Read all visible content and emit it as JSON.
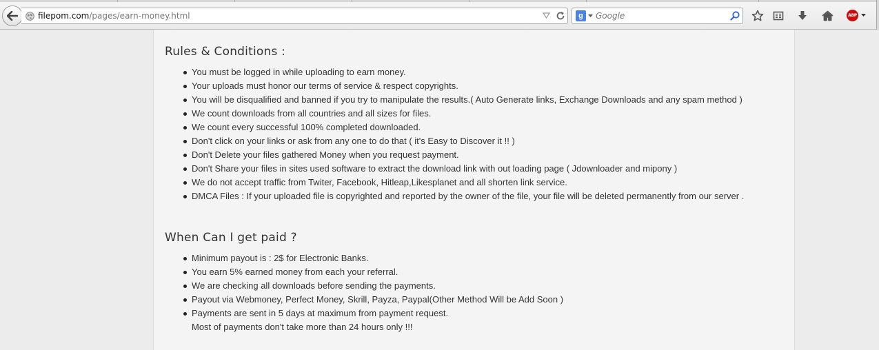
{
  "browser": {
    "url_host": "filepom.com",
    "url_path": "/pages/earn-money.html",
    "search_placeholder": "Google",
    "search_engine_badge": "g",
    "addon_badge": "ABP",
    "icons": [
      "back-arrow-icon",
      "globe-icon",
      "dropmarker-icon",
      "reload-icon",
      "google-icon",
      "magnifier-icon",
      "bookmark-star-icon",
      "reading-list-icon",
      "download-icon",
      "home-icon",
      "adblock-icon"
    ]
  },
  "rules": {
    "title": "Rules & Conditions :",
    "items": [
      "You must be logged in while uploading to earn money.",
      "Your uploads must honor our terms of service & respect copyrights.",
      "You will be disqualified and banned if you try to manipulate the results.( Auto Generate links, Exchange Downloads and any spam method )",
      "We count downloads from all countries and all sizes for files.",
      "We count every successful 100% completed downloaded.",
      "Don't click on your links or ask from any one to do that ( it's Easy to Discover it !! )",
      "Don't Delete your files gathered Money when you request payment.",
      "Don't Share your files in sites used software to extract the download link with out loading page ( Jdownloader and mipony )",
      "We do not accept traffic from Twiter, Facebook, Hitleap,Likesplanet and all shorten link service.",
      "DMCA Files : If your uploaded file is copyrighted and reported by the owner of the file, your file will be deleted permanently from our server ."
    ]
  },
  "payment": {
    "title": "When Can I get paid ?",
    "items": [
      "Minimum payout is : 2$ for Electronic Banks.",
      "You earn 5% earned money from each your referral.",
      "We are checking all downloads before sending the payments.",
      "Payout via Webmoney, Perfect Money, Skrill, Payza, Paypal(Other Method Will be Add Soon )",
      "Payments are sent in 5 days at maximum from payment request."
    ],
    "note": "Most of payments don't take more than 24 hours only !!!"
  },
  "colors": {
    "page_background": "#ececec",
    "panel_background": "#f4f4f4",
    "text": "#333333",
    "abp_red": "#c70d0d",
    "google_blue": "#4a80e8"
  }
}
